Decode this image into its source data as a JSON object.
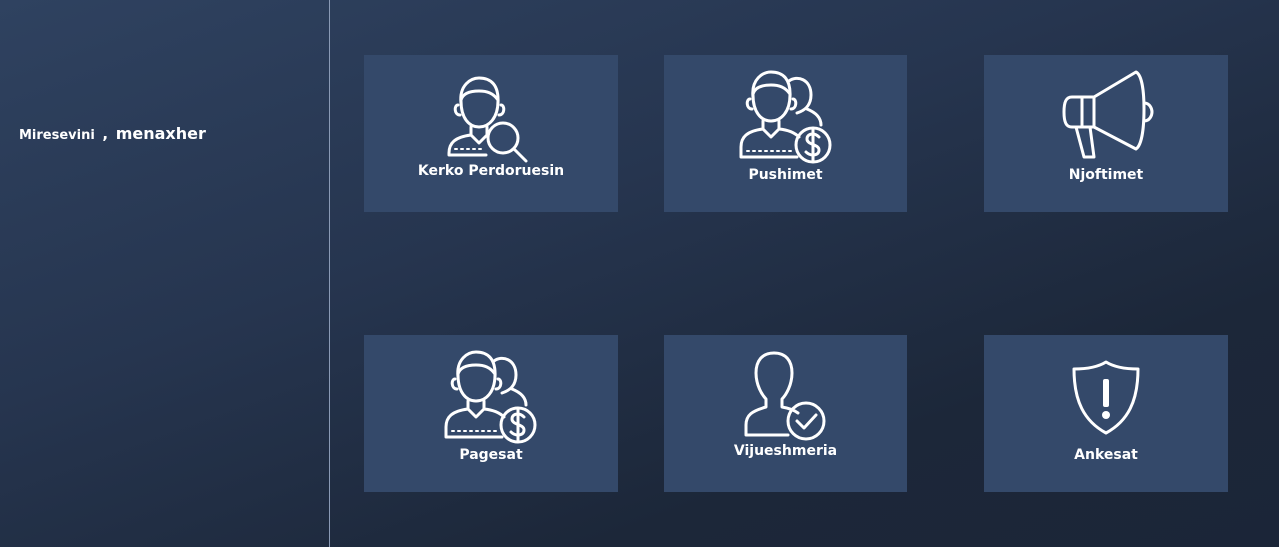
{
  "sidebar": {
    "greeting": "Miresevini",
    "separator": ",",
    "username": "menaxher"
  },
  "tiles": [
    {
      "label": "Kerko Perdoruesin",
      "icon": "user-search-icon"
    },
    {
      "label": "Pushimet",
      "icon": "users-dollar-icon"
    },
    {
      "label": "Njoftimet",
      "icon": "megaphone-icon"
    },
    {
      "label": "Pagesat",
      "icon": "users-dollar-icon"
    },
    {
      "label": "Vijueshmeria",
      "icon": "user-check-icon"
    },
    {
      "label": "Ankesat",
      "icon": "shield-alert-icon"
    }
  ],
  "colors": {
    "tile_background": "#34496a",
    "background_dark": "#1b2538",
    "background_light": "#2f4260",
    "text": "#ffffff"
  }
}
